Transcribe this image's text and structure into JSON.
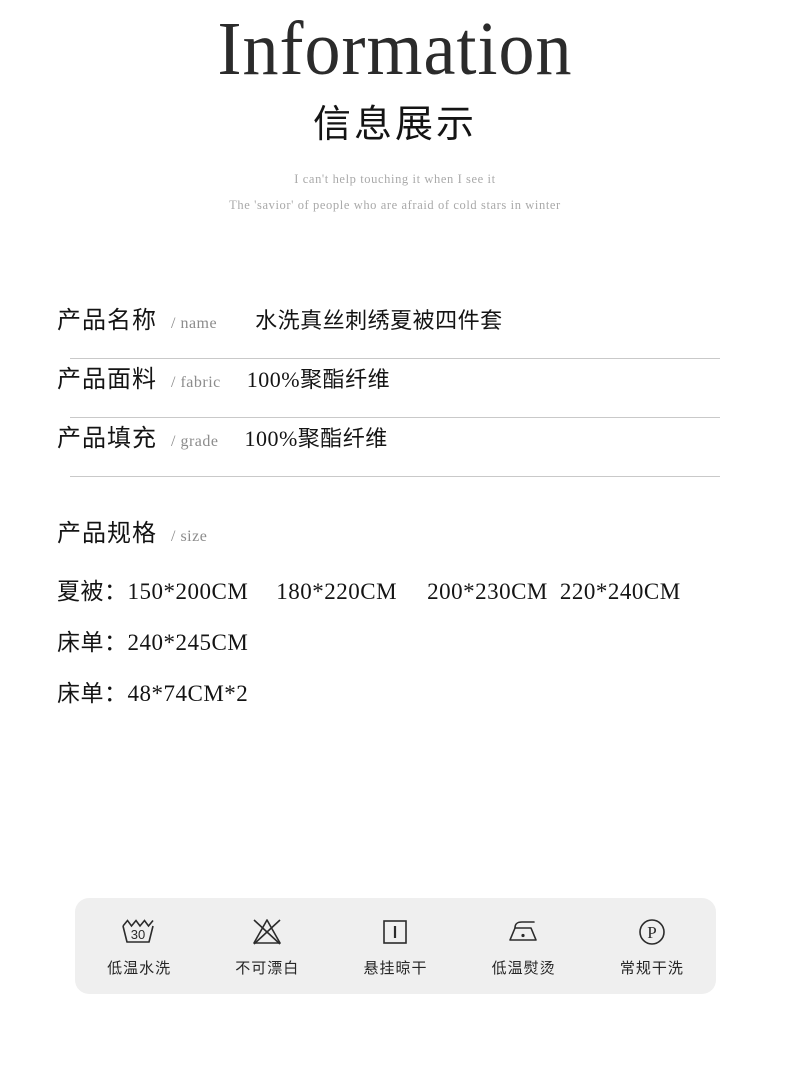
{
  "header": {
    "title_en": "Information",
    "title_cn": "信息展示",
    "subtitle_line1": "I can't help touching it when I see it",
    "subtitle_line2": "The 'savior' of people who are afraid of cold stars in winter"
  },
  "specs": [
    {
      "label_cn": "产品名称",
      "label_en": "/ name",
      "value": "水洗真丝刺绣夏被四件套"
    },
    {
      "label_cn": "产品面料",
      "label_en": "/ fabric",
      "value": "100%聚酯纤维"
    },
    {
      "label_cn": "产品填充",
      "label_en": "/ grade",
      "value": "100%聚酯纤维"
    }
  ],
  "size_section": {
    "label_cn": "产品规格",
    "label_en": "/ size",
    "lines": [
      {
        "name": "夏被：",
        "v1": "150*200CM",
        "v2": "180*220CM",
        "v3": "200*230CM",
        "v4": "220*240CM"
      },
      {
        "name": "床单：",
        "v1": "240*245CM",
        "v2": "",
        "v3": "",
        "v4": ""
      },
      {
        "name": "床单：",
        "v1": "48*74CM*2",
        "v2": "",
        "v3": "",
        "v4": ""
      }
    ]
  },
  "care": {
    "background": "#efefef",
    "items": [
      {
        "icon": "wash-basin-30-icon",
        "label": "低温水洗",
        "temp": "30"
      },
      {
        "icon": "no-bleach-triangle-crossed-icon",
        "label": "不可漂白"
      },
      {
        "icon": "hang-dry-square-icon",
        "label": "悬挂晾干"
      },
      {
        "icon": "iron-one-dot-icon",
        "label": "低温熨烫"
      },
      {
        "icon": "dry-clean-p-circle-icon",
        "label": "常规干洗"
      }
    ]
  },
  "colors": {
    "text_primary": "#141414",
    "text_muted": "#8c8c8c",
    "subtitle": "#a9a9a9",
    "divider": "#c9c9c9",
    "panel_bg": "#efefef"
  }
}
